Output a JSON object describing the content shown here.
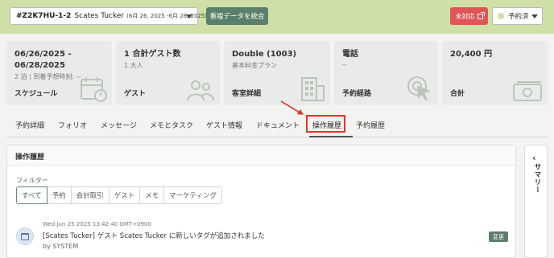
{
  "header": {
    "reservation_id": "#Z2K7HU-1-2",
    "guest_name": "Scates Tucker",
    "dates": "(6月 26, 2025 -6月 28, 2025)",
    "merge_label": "重複データを統合",
    "unhandled_label": "未対応",
    "status_label": "予約済",
    "status_color": "#cfe0a6"
  },
  "cards": [
    {
      "title": "06/26/2025 - 06/28/2025",
      "sub": "2 泊 | 到着予想時刻: --",
      "label": "スケジュール",
      "icon": "calendar-icon"
    },
    {
      "title": "1 合計ゲスト数",
      "sub": "1 大人",
      "label": "ゲスト",
      "icon": "people-icon"
    },
    {
      "title": "Double (1003)",
      "sub": "基本料金プラン",
      "label": "客室詳細",
      "icon": "building-icon"
    },
    {
      "title": "電話",
      "sub": "--",
      "label": "予約経路",
      "icon": "cursor-target-icon"
    },
    {
      "title": "20,400 円",
      "sub": "",
      "label": "合計",
      "icon": "money-icon"
    }
  ],
  "tabs": [
    "予約詳細",
    "フォリオ",
    "メッセージ",
    "メモとタスク",
    "ゲスト情報",
    "ドキュメント",
    "操作履歴",
    "予約履歴"
  ],
  "active_tab": "操作履歴",
  "panel": {
    "title": "操作履歴",
    "filter_label": "フィルター",
    "filters": [
      "すべて",
      "予約",
      "会計取引",
      "ゲスト",
      "メモ",
      "マーケティング"
    ]
  },
  "log": {
    "time": "Wed Jun 25 2025 13:42:40 GMT+0900",
    "text": "[Scates Tucker] ゲスト Scates Tucker に新しいタグが追加されました",
    "by": "by SYSTEM",
    "badge": "変更"
  },
  "summary": {
    "label": "サマリー"
  },
  "colors": {
    "accent_green": "#5c7f6c",
    "alert_red": "#e05656",
    "header_bg": "#cfe0a6",
    "highlight": "#e53222"
  }
}
